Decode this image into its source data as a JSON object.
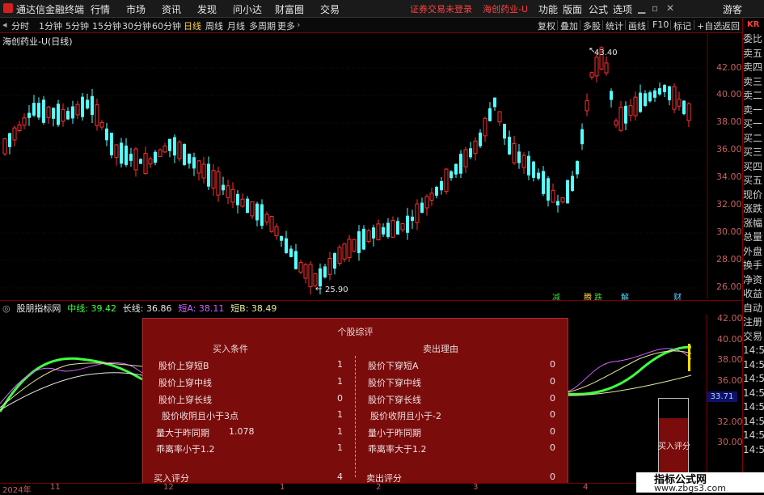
{
  "app": {
    "name": "通达信金融终端",
    "menu": [
      "行情",
      "市场",
      "资讯",
      "发现",
      "问小达",
      "财富圈",
      "交易"
    ],
    "alert": "证券交易未登录",
    "stock_in_title": "海创药业-U",
    "right_menu": [
      "功能",
      "版面",
      "公式",
      "选项"
    ],
    "guest": "游客"
  },
  "periods": [
    "分时",
    "1分钟",
    "5分钟",
    "15分钟",
    "30分钟",
    "60分钟",
    "日线",
    "周线",
    "月线",
    "多周期",
    "更多"
  ],
  "active_period": "日线",
  "toolbar_right": [
    "复权",
    "叠加",
    "多股",
    "统计",
    "画线",
    "F10",
    "标记",
    "+自选",
    "返回"
  ],
  "stock_title": "海创药业-U(日线)",
  "main_axis": [
    "42.00",
    "40.00",
    "38.00",
    "36.00",
    "34.00",
    "32.00",
    "30.00",
    "28.00",
    "26.00"
  ],
  "high_label": "43.40",
  "low_label": "25.90",
  "signals": [
    {
      "text": "减",
      "color": "#40d040"
    },
    {
      "text": "腾",
      "color": "#ffd24a"
    },
    {
      "text": "跌",
      "color": "#40d040"
    },
    {
      "text": "解",
      "color": "#5fd0ff"
    },
    {
      "text": "财",
      "color": "#5fd0ff"
    }
  ],
  "right_panel": {
    "logo": "KR",
    "items": [
      "委比",
      "卖五",
      "卖四",
      "卖三",
      "卖二",
      "卖一",
      "买一",
      "买二",
      "买三",
      "买四",
      "买五",
      "现价",
      "涨跌",
      "涨幅",
      "总量",
      "外盘",
      "换手",
      "净资",
      "收益",
      "自动",
      "注册",
      "交易",
      "14:5",
      "14:5",
      "14:5",
      "14:5",
      "14:5",
      "14:5",
      "14:5",
      "14:5"
    ]
  },
  "indicator": {
    "name": "股朋指标网",
    "mid": "中线: 39.42",
    "long": "长线: 36.86",
    "shortA": "短A: 38.11",
    "shortB": "短B: 38.49"
  },
  "ind_axis": [
    "42.00",
    "40.00",
    "38.00",
    "36.00",
    "34.00",
    "32.00",
    "30.00"
  ],
  "price_tag": "33.71",
  "popup": {
    "title": "个股综评",
    "buy_header": "买入条件",
    "sell_header": "卖出理由",
    "buy_rows": [
      {
        "label": "股价上穿短B",
        "value": "1"
      },
      {
        "label": "股价上穿中线",
        "value": "1"
      },
      {
        "label": "股价上穿长线",
        "value": "0"
      },
      {
        "label": "股价收阴且小于3点",
        "value": "1"
      },
      {
        "label": "量大于昨同期",
        "extra": "1.078",
        "value": "1"
      },
      {
        "label": "乖离率小于1.2",
        "value": "1"
      }
    ],
    "sell_rows": [
      {
        "label": "股价下穿短A",
        "value": "0"
      },
      {
        "label": "股价下穿中线",
        "value": "0"
      },
      {
        "label": "股价下穿长线",
        "value": "0"
      },
      {
        "label": "股价收阴且小于-2",
        "value": "0"
      },
      {
        "label": "量小于昨同期",
        "value": "0"
      },
      {
        "label": "乖离率大于1.2",
        "value": "0"
      }
    ],
    "buy_score_label": "买入评分",
    "buy_score": "4",
    "sell_score_label": "卖出评分",
    "sell_score": "0"
  },
  "score_box": {
    "label": "买入评分",
    "fill_fraction": 0.75
  },
  "date_axis": [
    "2024年",
    "11",
    "12",
    "1",
    "2",
    "3",
    "4"
  ],
  "watermark": {
    "line1": "指标公式网",
    "line2": "www.zbgs3.com"
  },
  "colors": {
    "up": "#ff3030",
    "down": "#54ffff",
    "panel_red": "#7a0c0c",
    "mid_line": "#40ff40",
    "shortA": "#d060ff",
    "shortB": "#e6e6a0"
  }
}
